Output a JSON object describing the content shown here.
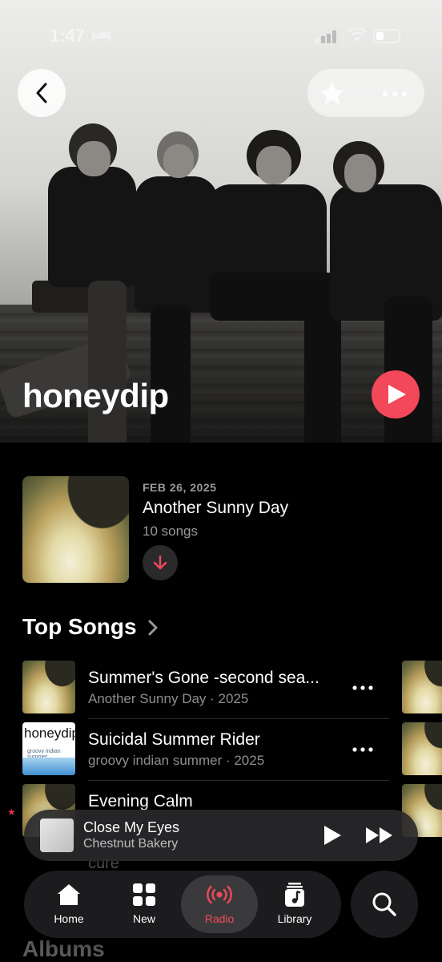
{
  "status_bar": {
    "time": "1:47"
  },
  "artist": {
    "name": "honeydip"
  },
  "latest_release": {
    "date": "FEB 26, 2025",
    "title": "Another Sunny Day",
    "count": "10 songs"
  },
  "top_songs": {
    "heading": "Top Songs",
    "items": [
      {
        "title": "Summer's Gone -second sea...",
        "subtitle": "Another Sunny Day · 2025"
      },
      {
        "title": "Suicidal Summer Rider",
        "subtitle": "groovy indian summer · 2025"
      },
      {
        "title": "Evening Calm",
        "subtitle": ""
      },
      {
        "title": "cure",
        "subtitle": ""
      }
    ]
  },
  "album_art_text": {
    "honeydip_word": "honeydip",
    "honeydip_sub": "groovy indian summer"
  },
  "now_playing": {
    "title": "Close My Eyes",
    "artist": "Chestnut Bakery"
  },
  "tabs": [
    {
      "label": "Home",
      "icon": "house-icon"
    },
    {
      "label": "New",
      "icon": "grid-icon"
    },
    {
      "label": "Radio",
      "icon": "radio-waves-icon",
      "active": true
    },
    {
      "label": "Library",
      "icon": "music-note-icon"
    }
  ],
  "albums_heading": "Albums",
  "colors": {
    "accent": "#f2485a",
    "background": "#000000",
    "secondary_text": "#8e8e8e"
  }
}
